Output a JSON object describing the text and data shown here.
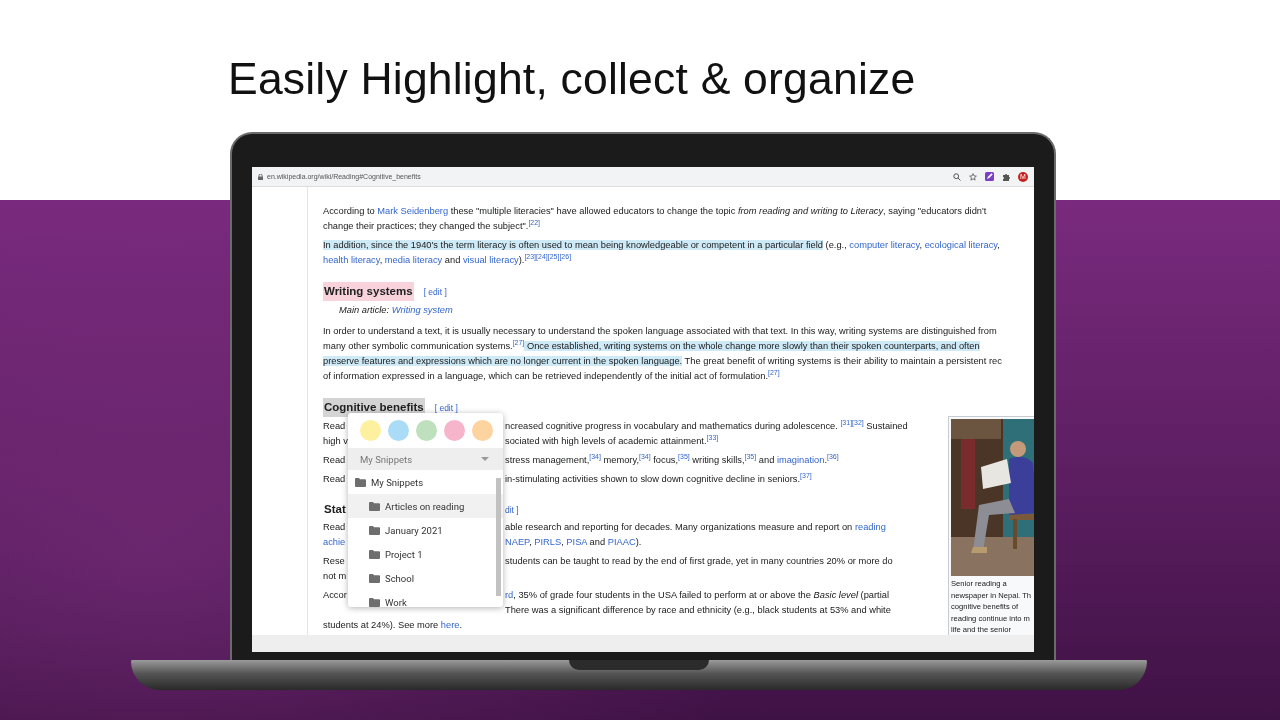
{
  "headline": "Easily Highlight, collect & organize",
  "browser": {
    "url": "en.wikipedia.org/wiki/Reading#Cognitive_benefits",
    "avatar_letter": "M"
  },
  "article": {
    "blocks": [
      {
        "kind": "paragraph",
        "lines": [
          {
            "spans": [
              {
                "kind": "plain",
                "text": "According to "
              },
              {
                "kind": "link",
                "text": "Mark Seidenberg"
              },
              {
                "kind": "plain",
                "text": " these \"multiple literacies\" have allowed educators to change the topic "
              },
              {
                "kind": "italic",
                "text": "from reading and writing to Literacy"
              },
              {
                "kind": "plain",
                "text": ", saying \"educators didn't"
              }
            ]
          },
          {
            "spans": [
              {
                "kind": "plain",
                "text": "change their practices; they changed the subject\"."
              },
              {
                "kind": "ref",
                "text": "[22]"
              }
            ]
          }
        ]
      },
      {
        "kind": "paragraph",
        "lines": [
          {
            "spans": [
              {
                "kind": "highlight",
                "color": "#cfeaf7",
                "text": "In addition, since the 1940's the term literacy is often used to mean being knowledgeable or competent in a particular field"
              },
              {
                "kind": "plain",
                "text": " (e.g., "
              },
              {
                "kind": "link",
                "text": "computer literacy"
              },
              {
                "kind": "plain",
                "text": ", "
              },
              {
                "kind": "link",
                "text": "ecological literacy"
              },
              {
                "kind": "plain",
                "text": ","
              }
            ]
          },
          {
            "spans": [
              {
                "kind": "link",
                "text": "health literacy"
              },
              {
                "kind": "plain",
                "text": ", "
              },
              {
                "kind": "link",
                "text": "media literacy"
              },
              {
                "kind": "plain",
                "text": " and "
              },
              {
                "kind": "link",
                "text": "visual literacy"
              },
              {
                "kind": "plain",
                "text": ")."
              },
              {
                "kind": "ref",
                "text": "[23][24][25][26]"
              }
            ]
          }
        ]
      },
      {
        "kind": "heading",
        "text": "Writing systems",
        "color": "#f9d3dc",
        "edit": "[ edit ]"
      },
      {
        "kind": "hatnote",
        "label": "Main article: ",
        "link": "Writing system"
      },
      {
        "kind": "paragraph",
        "lines": [
          {
            "spans": [
              {
                "kind": "plain",
                "text": "In order to understand a text, it is usually necessary to understand the spoken language associated with that text. In this way, writing systems are distinguished from"
              }
            ]
          },
          {
            "spans": [
              {
                "kind": "plain",
                "text": "many other symbolic communication systems."
              },
              {
                "kind": "ref",
                "text": "[27]"
              },
              {
                "kind": "highlight",
                "color": "#cfeaf7",
                "text": " Once established, writing systems on the whole change more slowly than their spoken counterparts, and often"
              }
            ]
          },
          {
            "spans": [
              {
                "kind": "highlight",
                "color": "#cfeaf7",
                "text": "preserve features and expressions which are no longer current in the spoken language."
              },
              {
                "kind": "plain",
                "text": " The great benefit of writing systems is their ability to maintain a persistent rec"
              }
            ]
          },
          {
            "spans": [
              {
                "kind": "plain",
                "text": "of information expressed in a language, which can be retrieved independently of the initial act of formulation."
              },
              {
                "kind": "ref",
                "text": "[27]"
              }
            ]
          }
        ]
      },
      {
        "kind": "heading",
        "text": "Cognitive benefits",
        "color": "#d4d4d4",
        "edit": "[ edit ]"
      },
      {
        "kind": "paragraph",
        "lines": [
          {
            "left": [
              {
                "kind": "plain",
                "text": "Read"
              }
            ],
            "right": [
              {
                "kind": "plain",
                "text": "ncreased cognitive progress in vocabulary and mathematics during adolescence. "
              },
              {
                "kind": "ref",
                "text": "[31][32]"
              },
              {
                "kind": "plain",
                "text": " Sustained"
              }
            ]
          },
          {
            "left": [
              {
                "kind": "plain",
                "text": "high v"
              }
            ],
            "right": [
              {
                "kind": "plain",
                "text": "sociated with high levels of academic attainment."
              },
              {
                "kind": "ref",
                "text": "[33]"
              }
            ]
          }
        ]
      },
      {
        "kind": "paragraph",
        "lines": [
          {
            "left": [
              {
                "kind": "plain",
                "text": "Read"
              }
            ],
            "right": [
              {
                "kind": "plain",
                "text": "stress management,"
              },
              {
                "kind": "ref",
                "text": "[34]"
              },
              {
                "kind": "plain",
                "text": " memory,"
              },
              {
                "kind": "ref",
                "text": "[34]"
              },
              {
                "kind": "plain",
                "text": " focus,"
              },
              {
                "kind": "ref",
                "text": "[35]"
              },
              {
                "kind": "plain",
                "text": " writing skills,"
              },
              {
                "kind": "ref",
                "text": "[35]"
              },
              {
                "kind": "plain",
                "text": " and "
              },
              {
                "kind": "link",
                "text": "imagination"
              },
              {
                "kind": "plain",
                "text": "."
              },
              {
                "kind": "ref",
                "text": "[36]"
              }
            ]
          }
        ]
      },
      {
        "kind": "paragraph",
        "lines": [
          {
            "left": [
              {
                "kind": "plain",
                "text": "Read"
              }
            ],
            "right": [
              {
                "kind": "plain",
                "text": "in-stimulating activities shown to slow down cognitive decline in seniors."
              },
              {
                "kind": "ref",
                "text": "[37]"
              }
            ]
          }
        ]
      },
      {
        "kind": "clippedheading",
        "text": "Stat",
        "edit": "dit ]"
      },
      {
        "kind": "paragraph",
        "lines": [
          {
            "left": [
              {
                "kind": "plain",
                "text": "Read"
              }
            ],
            "right": [
              {
                "kind": "plain",
                "text": "able research and reporting for decades. Many organizations measure and report on "
              },
              {
                "kind": "link",
                "text": "reading"
              }
            ]
          },
          {
            "left": [
              {
                "kind": "link",
                "text": "achie"
              }
            ],
            "right": [
              {
                "kind": "link",
                "text": "NAEP"
              },
              {
                "kind": "plain",
                "text": ", "
              },
              {
                "kind": "link",
                "text": "PIRLS"
              },
              {
                "kind": "plain",
                "text": ", "
              },
              {
                "kind": "link",
                "text": "PISA"
              },
              {
                "kind": "plain",
                "text": " and "
              },
              {
                "kind": "link",
                "text": "PIAAC"
              },
              {
                "kind": "plain",
                "text": ")."
              }
            ]
          }
        ]
      },
      {
        "kind": "paragraph",
        "lines": [
          {
            "left": [
              {
                "kind": "plain",
                "text": "Rese"
              }
            ],
            "right": [
              {
                "kind": "plain",
                "text": "students can be taught to read by the end of first grade, yet in many countries 20% or more do"
              }
            ]
          },
          {
            "left": [
              {
                "kind": "plain",
                "text": "not m"
              }
            ]
          }
        ]
      },
      {
        "kind": "paragraph",
        "lines": [
          {
            "left": [
              {
                "kind": "plain",
                "text": "Accor"
              }
            ],
            "right": [
              {
                "kind": "link",
                "text": "rd"
              },
              {
                "kind": "plain",
                "text": ", 35% of grade four students in the USA failed to perform at or above the "
              },
              {
                "kind": "italic",
                "text": "Basic level"
              },
              {
                "kind": "plain",
                "text": " (partial"
              }
            ]
          },
          {
            "right": [
              {
                "kind": "plain",
                "text": "There was a significant difference by race and ethnicity (e.g., black students at 53% and white"
              }
            ]
          },
          {
            "spans": [
              {
                "kind": "plain",
                "text": "students at 24%). See more "
              },
              {
                "kind": "link",
                "text": "here"
              },
              {
                "kind": "plain",
                "text": "."
              }
            ]
          }
        ]
      },
      {
        "kind": "figure",
        "caption_lines": [
          "Senior reading a",
          "newspaper in Nepal. Th",
          "cognitive benefits of",
          "reading continue into m",
          "life and the senior"
        ]
      }
    ]
  },
  "popup": {
    "colors": [
      {
        "color": "#fdf1a0"
      },
      {
        "color": "#aadcf7"
      },
      {
        "color": "#bfe0bd"
      },
      {
        "color": "#f7b5cb"
      },
      {
        "color": "#fdd3a0"
      }
    ],
    "dropdown": {
      "value": "My Snippets"
    },
    "folders": [
      {
        "name": "My Snippets",
        "selected": false,
        "children": [
          {
            "name": "Articles on reading",
            "selected": true
          },
          {
            "name": "January 2021",
            "selected": false
          },
          {
            "name": "Project 1",
            "selected": false
          },
          {
            "name": "School",
            "selected": false
          },
          {
            "name": "Work",
            "selected": false
          }
        ]
      }
    ]
  }
}
